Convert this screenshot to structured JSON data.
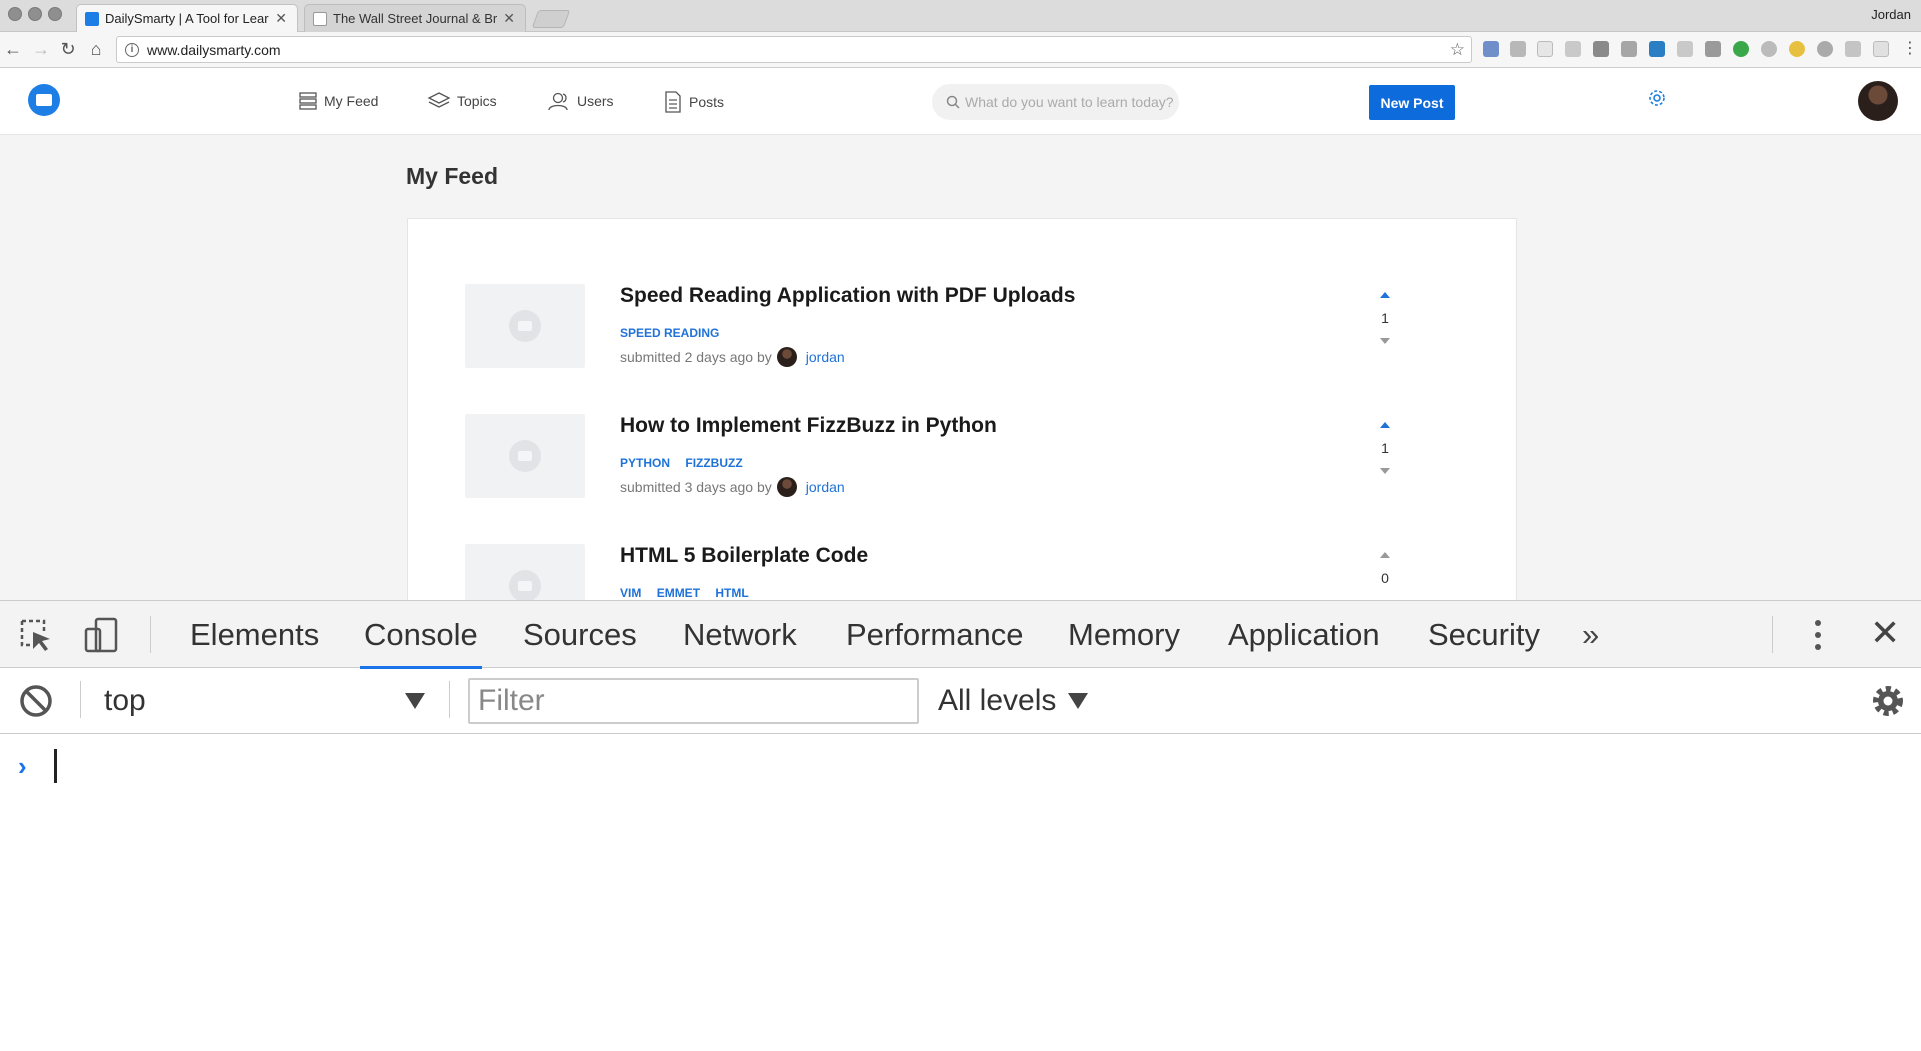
{
  "browser": {
    "tabs": [
      {
        "title": "DailySmarty | A Tool for Learni",
        "active": true
      },
      {
        "title": "The Wall Street Journal & Brea",
        "active": false
      }
    ],
    "profile_name": "Jordan",
    "url": "www.dailysmarty.com"
  },
  "site": {
    "nav": [
      {
        "label": "My Feed",
        "icon": "feed-icon"
      },
      {
        "label": "Topics",
        "icon": "layers-icon"
      },
      {
        "label": "Users",
        "icon": "users-icon"
      },
      {
        "label": "Posts",
        "icon": "document-icon"
      }
    ],
    "search_placeholder": "What do you want to learn today?",
    "new_post_label": "New Post",
    "accent_color": "#0d6bdc"
  },
  "feed": {
    "title": "My Feed",
    "posts": [
      {
        "title": "Speed Reading Application with PDF Uploads",
        "tags": [
          "SPEED READING"
        ],
        "submitted": "submitted 2 days ago by",
        "author": "jordan",
        "votes": "1",
        "upvoted": true
      },
      {
        "title": "How to Implement FizzBuzz in Python",
        "tags": [
          "PYTHON",
          "FIZZBUZZ"
        ],
        "submitted": "submitted 3 days ago by",
        "author": "jordan",
        "votes": "1",
        "upvoted": true
      },
      {
        "title": "HTML 5 Boilerplate Code",
        "tags": [
          "VIM",
          "EMMET",
          "HTML"
        ],
        "submitted": "",
        "author": "",
        "votes": "0",
        "upvoted": false
      }
    ]
  },
  "devtools": {
    "tabs": [
      "Elements",
      "Console",
      "Sources",
      "Network",
      "Performance",
      "Memory",
      "Application",
      "Security"
    ],
    "active_tab": "Console",
    "more_label": "»",
    "context": "top",
    "filter_placeholder": "Filter",
    "levels_label": "All levels",
    "prompt": "›"
  }
}
